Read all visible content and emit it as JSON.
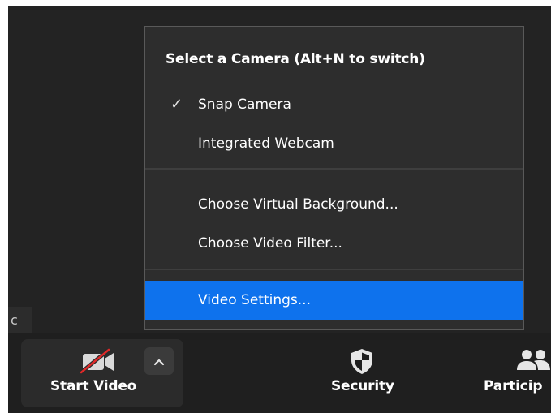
{
  "side": {
    "label": "c"
  },
  "camera_menu": {
    "heading": "Select a Camera (Alt+N to switch)",
    "check_mark": "✓",
    "items": [
      {
        "label": "Snap Camera",
        "checked": true
      },
      {
        "label": "Integrated Webcam",
        "checked": false
      }
    ],
    "background_items": [
      {
        "label": "Choose Virtual Background..."
      },
      {
        "label": "Choose Video Filter..."
      }
    ],
    "settings_item": {
      "label": "Video Settings...",
      "highlighted": true
    }
  },
  "toolbar": {
    "start_video": {
      "label": "Start Video",
      "icon": "video-off-icon"
    },
    "caret": {
      "icon": "chevron-up-icon"
    },
    "security": {
      "label": "Security",
      "icon": "shield-icon"
    },
    "participants": {
      "label": "Particip",
      "icon": "participants-icon"
    }
  },
  "colors": {
    "background": "#232323",
    "menu_bg": "#2d2d2d",
    "highlight": "#0e72ed",
    "video_off_slash": "#e02828"
  }
}
